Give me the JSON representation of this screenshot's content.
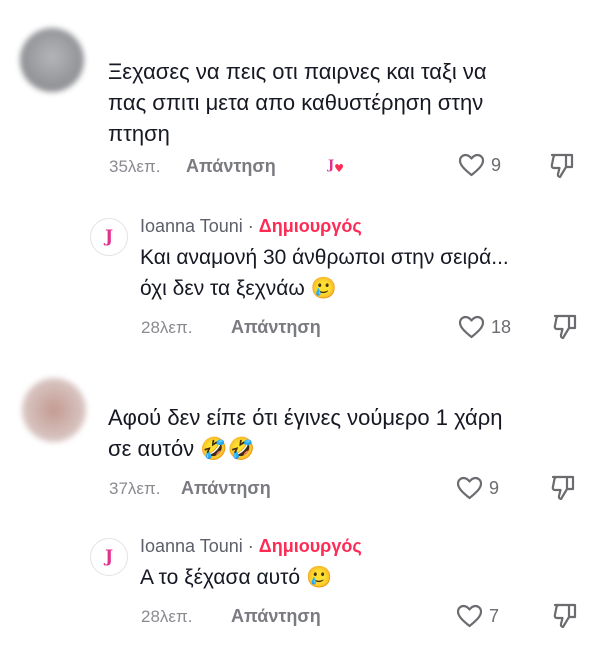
{
  "comments": [
    {
      "text_line1": "Ξεχασες να πεις οτι παιρνες και ταξι να",
      "text_line2": "πας σπιτι μετα απο καθυστέρηση στην",
      "text_line3": "πτηση",
      "time": "35λεπ.",
      "reply_label": "Απάντηση",
      "creator_liked_mark": "J",
      "likes": "9"
    },
    {
      "author": "Ioanna Touni",
      "separator": " · ",
      "badge": "Δημιουργός",
      "avatar_letter": "J",
      "text_line1": "Και αναμονή 30 άνθρωποι στην σειρά...",
      "text_line2": "όχι δεν τα ξεχνάω",
      "emoji": "🥲",
      "time": "28λεπ.",
      "reply_label": "Απάντηση",
      "likes": "18"
    },
    {
      "text_line1": "Αφού δεν είπε ότι έγινες νούμερο 1 χάρη",
      "text_line2": "σε αυτόν",
      "emoji": "🤣🤣",
      "time": "37λεπ.",
      "reply_label": "Απάντηση",
      "likes": "9"
    },
    {
      "author": "Ioanna Touni",
      "separator": " · ",
      "badge": "Δημιουργός",
      "avatar_letter": "J",
      "text_line1": "Α το ξέχασα αυτό",
      "emoji": "🥲",
      "time": "28λεπ.",
      "reply_label": "Απάντηση",
      "likes": "7"
    }
  ],
  "colors": {
    "accent": "#fe2c55",
    "logo": "#e0318f",
    "meta": "#8a8b91"
  },
  "icons": {
    "like": "heart-outline-icon",
    "dislike": "thumbs-down-icon"
  }
}
